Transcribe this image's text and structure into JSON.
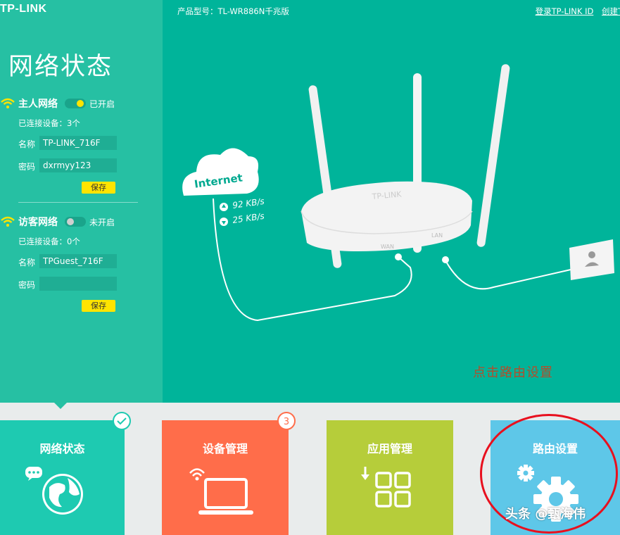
{
  "brand": {
    "logo_text": "TP-LINK"
  },
  "left_panel": {
    "title": "网络状态",
    "main_network": {
      "name": "主人网络",
      "state": "已开启",
      "connected": "已连接设备：3个",
      "ssid_label": "名称",
      "ssid_value": "TP-LINK_716F",
      "password_label": "密码",
      "password_value": "dxrmyy123",
      "save_label": "保存"
    },
    "guest_network": {
      "name": "访客网络",
      "state": "未开启",
      "connected": "已连接设备：0个",
      "ssid_label": "名称",
      "ssid_value": "TPGuest_716F",
      "password_label": "密码",
      "password_value": "",
      "save_label": "保存"
    }
  },
  "header": {
    "product_model": "产品型号：TL-WR886N千兆版",
    "login_link": "登录TP-LINK ID",
    "create_link": "创建T"
  },
  "diagram": {
    "internet_label": "Internet",
    "upload_speed": "92 KB/s",
    "download_speed": "25 KB/s",
    "wan_label": "WAN",
    "lan_label": "LAN",
    "router_brand": "TP-LINK"
  },
  "annotation": {
    "hint_text": "点击路由设置"
  },
  "tiles": [
    {
      "label": "网络状态",
      "badge": "",
      "icon": "globe-chat-icon"
    },
    {
      "label": "设备管理",
      "badge": "3",
      "icon": "laptop-wifi-icon"
    },
    {
      "label": "应用管理",
      "badge": "",
      "icon": "app-grid-icon"
    },
    {
      "label": "路由设置",
      "badge": "",
      "icon": "gear-icon"
    }
  ],
  "watermark": "头条 @甄海伟",
  "colors": {
    "left_panel": "#26c0a3",
    "hero": "#00b49a",
    "tile_status": "#1ecab1",
    "tile_devices": "#ff6d4a",
    "tile_apps": "#b6cd3a",
    "tile_router": "#5ec7e8",
    "save_button": "#ffe400",
    "annotation_circle": "#e8101e"
  }
}
